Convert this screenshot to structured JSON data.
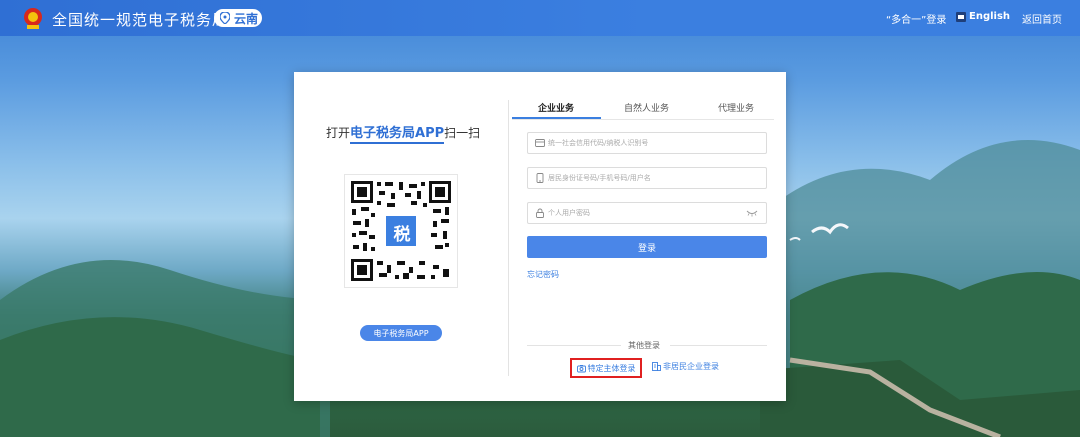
{
  "header": {
    "site_title": "全国统一规范电子税务局",
    "region": "云南",
    "multi_login": "“多合一”登录",
    "english": "English",
    "home": "返回首页"
  },
  "qr_panel": {
    "scan_prefix": "打开",
    "app_name": "电子税务局APP",
    "scan_suffix": "扫一扫",
    "qr_center_char": "税",
    "app_button": "电子税务局APP"
  },
  "tabs": [
    {
      "label": "企业业务",
      "active": true
    },
    {
      "label": "自然人业务",
      "active": false
    },
    {
      "label": "代理业务",
      "active": false
    }
  ],
  "form": {
    "credit_code_placeholder": "统一社会信用代码/纳税人识别号",
    "id_placeholder": "居民身份证号码/手机号码/用户名",
    "password_placeholder": "个人用户密码",
    "login_button": "登录",
    "forgot_password": "忘记密码"
  },
  "other_login": {
    "label": "其他登录",
    "special_entity": "特定主体登录",
    "nonresident": "非居民企业登录"
  },
  "colors": {
    "brand_blue": "#3b7fe0",
    "highlight_red": "#e02020"
  }
}
